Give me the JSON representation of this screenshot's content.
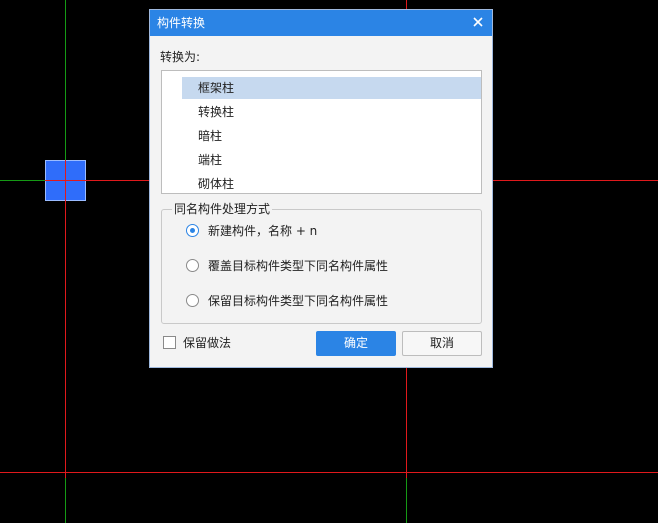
{
  "canvas": {
    "background": "#000000",
    "axis_line_color": "#e0191c",
    "green_line_color": "#159a15",
    "column_marker_color": "#2f6dfa"
  },
  "dialog": {
    "title": "构件转换",
    "close_icon": "close-icon",
    "convert_to_label": "转换为:",
    "options": [
      {
        "label": "框架柱",
        "selected": true
      },
      {
        "label": "转换柱",
        "selected": false
      },
      {
        "label": "暗柱",
        "selected": false
      },
      {
        "label": "端柱",
        "selected": false
      },
      {
        "label": "砌体柱",
        "selected": false
      }
    ],
    "same_name_group": {
      "title": "同名构件处理方式",
      "radios": [
        {
          "label": "新建构件，名称 + n",
          "checked": true
        },
        {
          "label": "覆盖目标构件类型下同名构件属性",
          "checked": false
        },
        {
          "label": "保留目标构件类型下同名构件属性",
          "checked": false
        }
      ]
    },
    "keep_method_label": "保留做法",
    "keep_method_checked": false,
    "ok_label": "确定",
    "cancel_label": "取消"
  },
  "colors": {
    "title_bar": "#2b84e5",
    "primary_button": "#2b84e5",
    "selected_item": "#c6d9ef"
  }
}
